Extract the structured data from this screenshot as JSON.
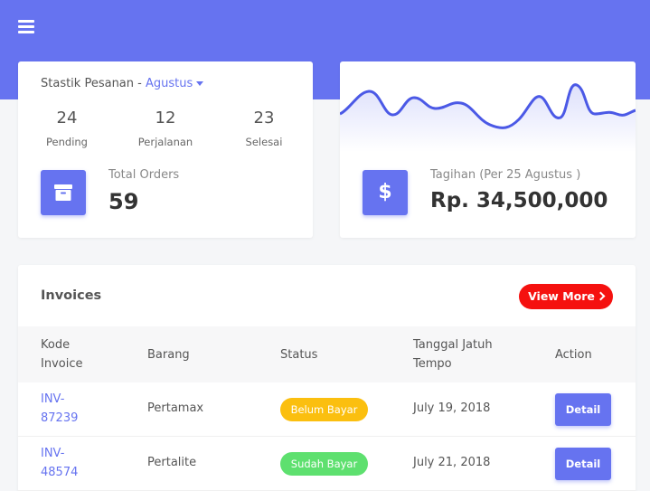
{
  "colors": {
    "primary": "#6673f0",
    "danger": "#f5110f",
    "warning": "#fbbf0f",
    "success": "#5ee06f"
  },
  "orders_card": {
    "title": "Stastik Pesanan -",
    "month": "Agustus",
    "stats": [
      {
        "value": "24",
        "label": "Pending"
      },
      {
        "value": "12",
        "label": "Perjalanan"
      },
      {
        "value": "23",
        "label": "Selesai"
      }
    ],
    "icon": "archive-box-icon",
    "total_label": "Total Orders",
    "total_value": "59"
  },
  "bill_card": {
    "icon": "dollar-icon",
    "icon_glyph": "$",
    "label": "Tagihan (Per 25 Agustus )",
    "value": "Rp. 34,500,000"
  },
  "invoices": {
    "title": "Invoices",
    "view_more": "View More",
    "columns": [
      "Kode",
      "Invoice",
      "Barang",
      "Status",
      "Tanggal Jatuh",
      "Tempo",
      "Action"
    ],
    "rows": [
      {
        "code_line1": "INV-",
        "code_line2": "87239",
        "item": "Pertamax",
        "status": "Belum Bayar",
        "due": "July 19, 2018",
        "action": "Detail"
      },
      {
        "code_line1": "INV-",
        "code_line2": "48574",
        "item": "Pertalite",
        "status": "Sudah Bayar",
        "due": "July 21, 2018",
        "action": "Detail"
      }
    ]
  }
}
